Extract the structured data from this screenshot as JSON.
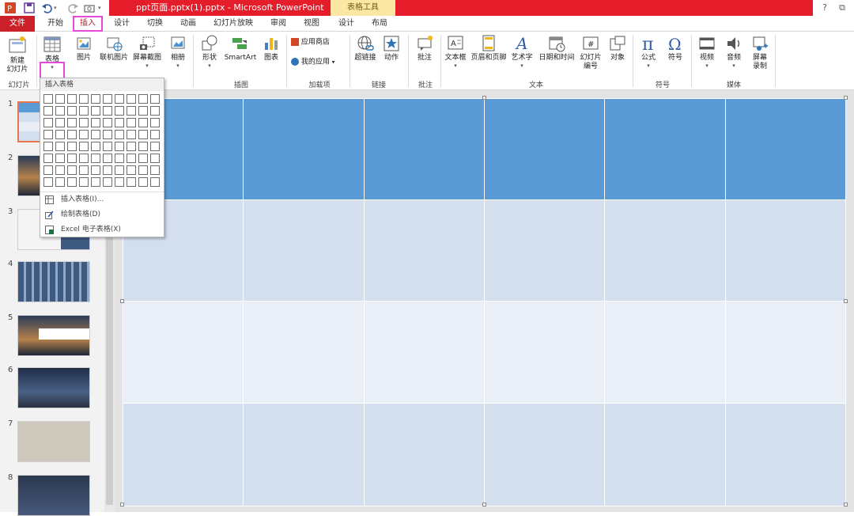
{
  "titlebar": {
    "document_title": "ppt页面.pptx(1).pptx -  Microsoft PowerPoint",
    "context_tool_header": "表格工具",
    "help": "?",
    "restore": "⧉"
  },
  "tabs": {
    "file": "文件",
    "home": "开始",
    "insert": "插入",
    "design": "设计",
    "transitions": "切换",
    "animations": "动画",
    "slideshow": "幻灯片放映",
    "review": "审阅",
    "view": "视图",
    "table_design": "设计",
    "table_layout": "布局"
  },
  "ribbon": {
    "new_slide": "新建\n幻灯片",
    "table": "表格",
    "picture": "图片",
    "online_picture": "联机图片",
    "screenshot": "屏幕截图",
    "album": "相册",
    "shapes": "形状",
    "smartart": "SmartArt",
    "chart": "图表",
    "app_store": "应用商店",
    "my_apps": "我的应用",
    "hyperlink": "超链接",
    "action": "动作",
    "comment": "批注",
    "textbox": "文本框",
    "header_footer": "页眉和页脚",
    "wordart": "艺术字",
    "datetime": "日期和时间",
    "slide_number": "幻灯片\n编号",
    "object": "对象",
    "equation": "公式",
    "symbol": "符号",
    "video": "视频",
    "audio": "音频",
    "screen_record": "屏幕\n录制",
    "groups": {
      "slides": "幻灯片",
      "illustrations": "插图",
      "addins": "加载项",
      "links": "链接",
      "comments": "批注",
      "text": "文本",
      "symbols": "符号",
      "media": "媒体"
    }
  },
  "dropdown": {
    "header": "插入表格",
    "insert_table": "插入表格(I)...",
    "draw_table": "绘制表格(D)",
    "excel_table": "Excel 电子表格(X)"
  },
  "thumbnails": {
    "numbers": [
      "1",
      "2",
      "3",
      "4",
      "5",
      "6",
      "7",
      "8"
    ]
  },
  "colors": {
    "accent_red": "#e51d2a",
    "highlight_pink": "#e649d8",
    "table_header_blue": "#5b9bd5",
    "table_band_light": "#d3deef",
    "table_band_lighter": "#e9eef7"
  }
}
